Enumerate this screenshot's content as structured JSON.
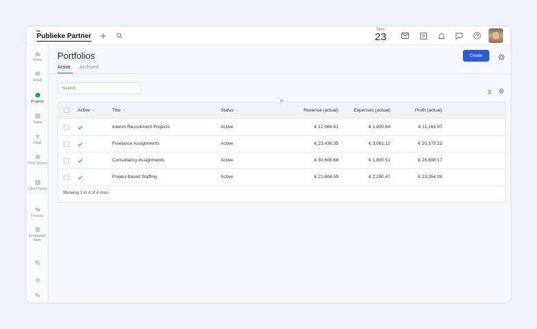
{
  "brand": {
    "small": "DE",
    "name": "Publieke Partner"
  },
  "topbar": {
    "date_month": "Mon",
    "date_day": "23",
    "icons": [
      "plus-icon",
      "search-icon",
      "mail-icon",
      "notes-icon",
      "bell-icon",
      "chat-icon",
      "help-icon"
    ]
  },
  "sidebar": {
    "items": [
      {
        "label": "Home"
      },
      {
        "label": "Email"
      },
      {
        "label": "Projects"
      },
      {
        "label": "Tasks"
      },
      {
        "label": "CRM"
      },
      {
        "label": "Time Tracker"
      },
      {
        "label": "Client Portal"
      },
      {
        "label": "Finance"
      },
      {
        "label": "Knowledge Base"
      }
    ]
  },
  "page": {
    "title": "Portfolios",
    "tabs": [
      {
        "label": "Active"
      },
      {
        "label": "Archived"
      }
    ],
    "create_label": "Create",
    "search_placeholder": "Search"
  },
  "table": {
    "headers": {
      "active": "Active",
      "title": "Title",
      "status": "Status",
      "revenue": "Revenue (actual)",
      "expenses": "Expenses (actual)",
      "profit": "Profit (actual)"
    },
    "rows": [
      {
        "title": "Interim Recruitment Projects",
        "status": "Active",
        "revenue": "€ 12,964.61",
        "expenses": "€ 1,800.64",
        "profit": "€ 11,163.97"
      },
      {
        "title": "Freelance Assignments",
        "status": "Active",
        "revenue": "€ 23,436.35",
        "expenses": "€ 3,061.12",
        "profit": "€ 20,375.22"
      },
      {
        "title": "Consultancy Assignments",
        "status": "Active",
        "revenue": "€ 30,608.68",
        "expenses": "€ 1,800.51",
        "profit": "€ 28,808.17"
      },
      {
        "title": "Project-based Staffing",
        "status": "Active",
        "revenue": "€ 21,604.55",
        "expenses": "€ 2,250.47",
        "profit": "€ 19,354.08"
      }
    ],
    "footer": "Showing 1 to 4 of 4 rows"
  },
  "colors": {
    "accent": "#2f5bd9",
    "check": "#22b07d",
    "background": "#eef2fc"
  }
}
